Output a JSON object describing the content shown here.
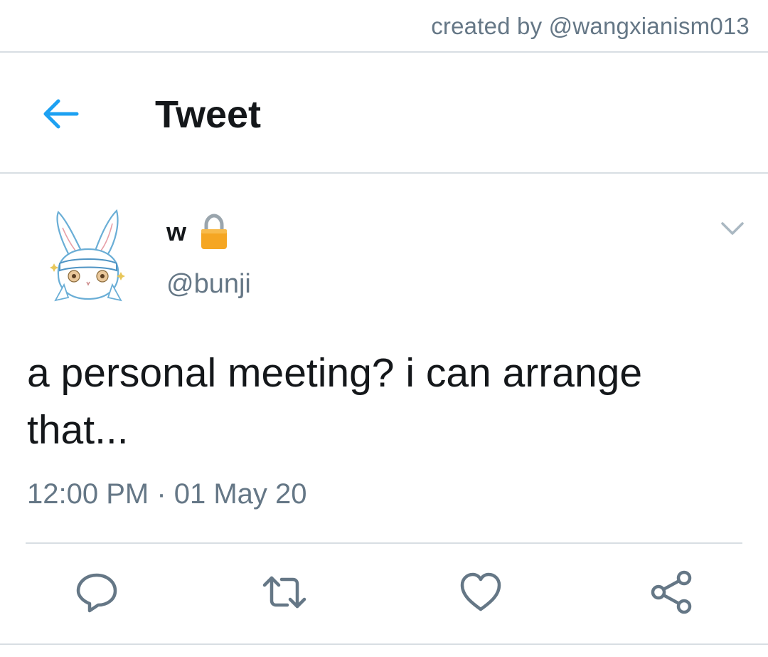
{
  "credit": {
    "text": "created by @wangxianism013"
  },
  "header": {
    "title": "Tweet",
    "back_icon": "arrow-left-icon"
  },
  "tweet": {
    "display_name": "w",
    "protected_icon": "lock-icon",
    "handle": "@bunji",
    "text": "a personal meeting? i can arrange that...",
    "timestamp": "12:00 PM · 01 May 20",
    "avatar": "white-rabbit-avatar",
    "more_icon": "chevron-down-icon"
  },
  "actions": {
    "reply_icon": "reply-icon",
    "retweet_icon": "retweet-icon",
    "like_icon": "heart-icon",
    "share_icon": "share-icon"
  },
  "colors": {
    "accent": "#1da1f2",
    "text_primary": "#14171a",
    "text_secondary": "#657786",
    "divider": "#d8dee3",
    "lock": "#f5a623"
  }
}
